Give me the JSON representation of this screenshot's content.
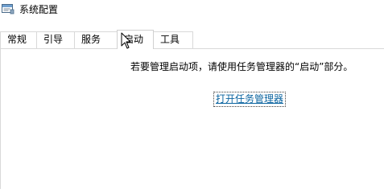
{
  "window": {
    "title": "系统配置",
    "icon": "system-configuration-icon"
  },
  "tabs": [
    {
      "label": "常规",
      "selected": false
    },
    {
      "label": "引导",
      "selected": false
    },
    {
      "label": "服务",
      "selected": false
    },
    {
      "label": "启动",
      "selected": true
    },
    {
      "label": "工具",
      "selected": false
    }
  ],
  "startup": {
    "message": "若要管理启动项，请使用任务管理器的“启动”部分。",
    "link_label": "打开任务管理器"
  },
  "colors": {
    "link": "#0b64a0",
    "border": "#d9d9d9"
  }
}
